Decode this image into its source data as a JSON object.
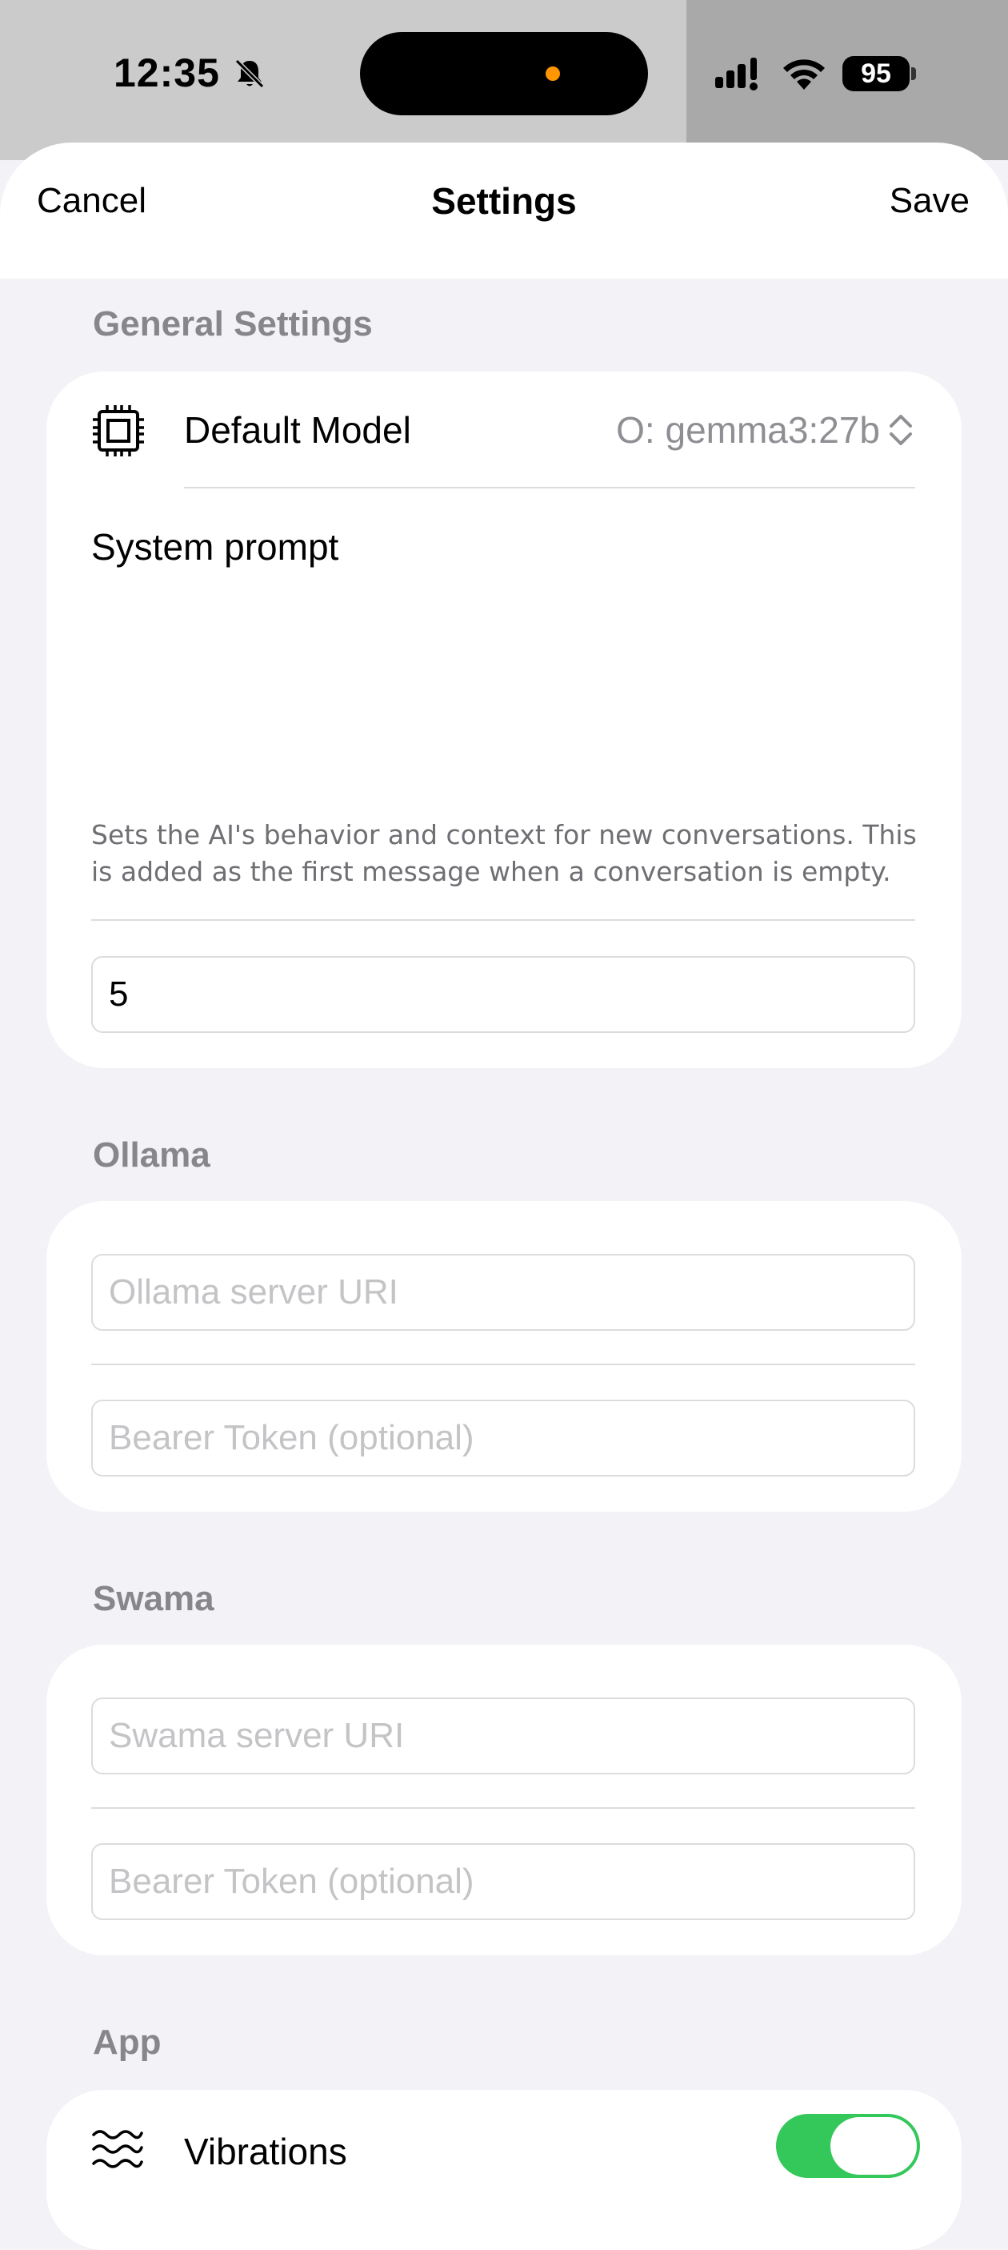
{
  "status_bar": {
    "time": "12:35",
    "battery": "95"
  },
  "nav": {
    "cancel": "Cancel",
    "title": "Settings",
    "save": "Save"
  },
  "general": {
    "header": "General Settings",
    "default_model_label": "Default Model",
    "default_model_value": "O: gemma3:27b",
    "system_prompt_label": "System prompt",
    "system_prompt_value": "",
    "system_prompt_hint": "Sets the AI's behavior and context for new conversations. This is added as the first message when a conversation is empty.",
    "number_value": "5"
  },
  "ollama": {
    "header": "Ollama",
    "server_placeholder": "Ollama server URI",
    "token_placeholder": "Bearer Token (optional)"
  },
  "swama": {
    "header": "Swama",
    "server_placeholder": "Swama server URI",
    "token_placeholder": "Bearer Token (optional)"
  },
  "app": {
    "header": "App",
    "vibrations_label": "Vibrations",
    "vibrations_on": true
  },
  "colors": {
    "toggle_on": "#34c759",
    "background": "#f2f2f7",
    "secondary_text": "#86868b"
  }
}
